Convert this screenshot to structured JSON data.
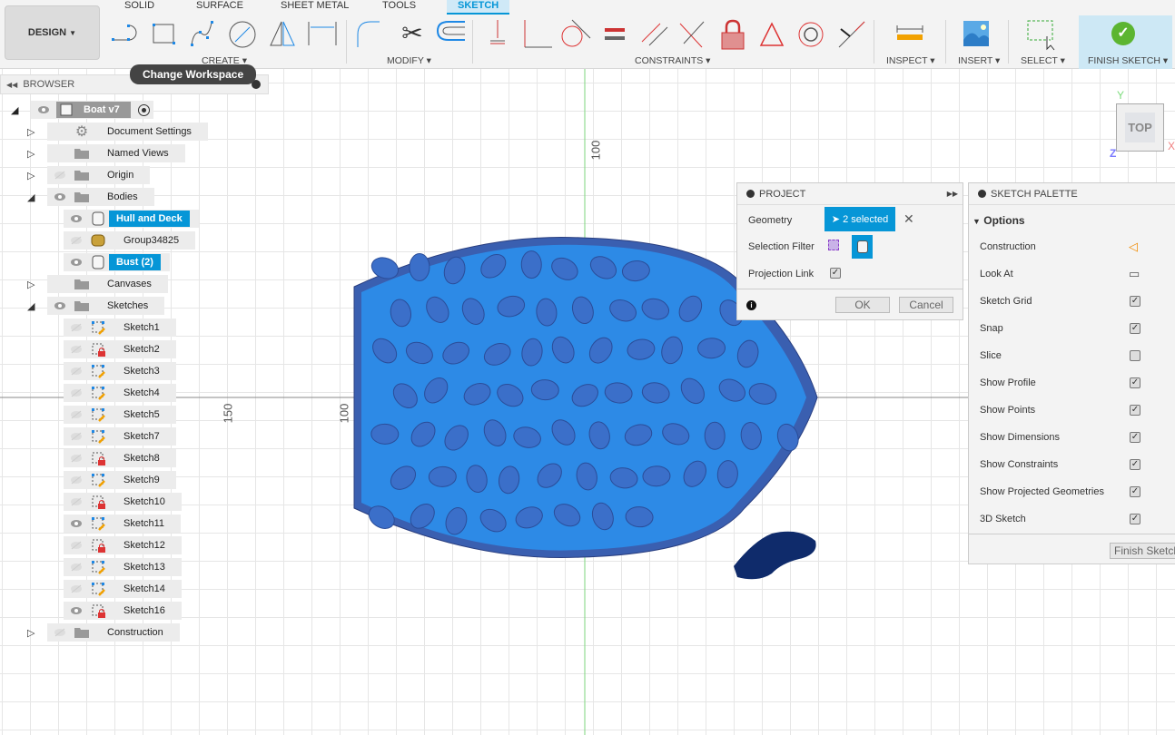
{
  "toolbar": {
    "workspace": "DESIGN",
    "tabs": [
      {
        "label": "SOLID"
      },
      {
        "label": "SURFACE"
      },
      {
        "label": "SHEET METAL"
      },
      {
        "label": "TOOLS"
      },
      {
        "label": "SKETCH",
        "active": true
      }
    ],
    "groups": {
      "create": "CREATE",
      "modify": "MODIFY",
      "constraints": "CONSTRAINTS",
      "inspect": "INSPECT",
      "insert": "INSERT",
      "select": "SELECT",
      "finish": "FINISH SKETCH"
    },
    "tooltip": "Change Workspace",
    "accent": "#0696d7"
  },
  "browser": {
    "title": "BROWSER",
    "root": "Boat v7",
    "items": [
      {
        "label": "Document Settings",
        "icon": "gear-icon",
        "visible": null,
        "expand": "collapsed"
      },
      {
        "label": "Named Views",
        "icon": "folder-icon",
        "visible": null,
        "expand": "collapsed"
      },
      {
        "label": "Origin",
        "icon": "folder-icon",
        "visible": false,
        "expand": "collapsed"
      },
      {
        "label": "Bodies",
        "icon": "folder-icon",
        "visible": true,
        "expand": "expanded"
      },
      {
        "label": "Hull and Deck",
        "icon": "body-icon",
        "visible": true,
        "selected": true
      },
      {
        "label": "Group34825",
        "icon": "mesh-icon",
        "visible": false
      },
      {
        "label": "Bust (2)",
        "icon": "body-icon",
        "visible": true,
        "selected": true
      },
      {
        "label": "Canvases",
        "icon": "folder-icon",
        "visible": null,
        "expand": "collapsed"
      },
      {
        "label": "Sketches",
        "icon": "folder-icon",
        "visible": true,
        "expand": "expanded"
      }
    ],
    "sketches": [
      {
        "label": "Sketch1",
        "locked": false,
        "visible": false
      },
      {
        "label": "Sketch2",
        "locked": true,
        "visible": false
      },
      {
        "label": "Sketch3",
        "locked": false,
        "visible": false
      },
      {
        "label": "Sketch4",
        "locked": false,
        "visible": false
      },
      {
        "label": "Sketch5",
        "locked": false,
        "visible": false
      },
      {
        "label": "Sketch7",
        "locked": false,
        "visible": false
      },
      {
        "label": "Sketch8",
        "locked": true,
        "visible": false
      },
      {
        "label": "Sketch9",
        "locked": false,
        "visible": false
      },
      {
        "label": "Sketch10",
        "locked": true,
        "visible": false
      },
      {
        "label": "Sketch11",
        "locked": false,
        "visible": true
      },
      {
        "label": "Sketch12",
        "locked": true,
        "visible": false
      },
      {
        "label": "Sketch13",
        "locked": false,
        "visible": false
      },
      {
        "label": "Sketch14",
        "locked": false,
        "visible": false
      },
      {
        "label": "Sketch16",
        "locked": true,
        "visible": true
      }
    ],
    "construction": "Construction"
  },
  "viewport": {
    "labels": {
      "top_100": "100",
      "left_150": "150",
      "left_100": "100"
    },
    "viewcube": {
      "face": "TOP",
      "x": "X",
      "y": "Y",
      "z": "Z"
    }
  },
  "project": {
    "title": "PROJECT",
    "geometry_label": "Geometry",
    "geometry_value": "2 selected",
    "filter_label": "Selection Filter",
    "link_label": "Projection Link",
    "link_checked": true,
    "ok": "OK",
    "cancel": "Cancel"
  },
  "palette": {
    "title": "SKETCH PALETTE",
    "section": "Options",
    "rows": [
      {
        "label": "Construction",
        "type": "icon"
      },
      {
        "label": "Look At",
        "type": "icon"
      },
      {
        "label": "Sketch Grid",
        "checked": true
      },
      {
        "label": "Snap",
        "checked": true
      },
      {
        "label": "Slice",
        "checked": false
      },
      {
        "label": "Show Profile",
        "checked": true
      },
      {
        "label": "Show Points",
        "checked": true
      },
      {
        "label": "Show Dimensions",
        "checked": true
      },
      {
        "label": "Show Constraints",
        "checked": true
      },
      {
        "label": "Show Projected Geometries",
        "checked": true
      },
      {
        "label": "3D Sketch",
        "checked": true
      }
    ],
    "finish": "Finish Sketch"
  }
}
